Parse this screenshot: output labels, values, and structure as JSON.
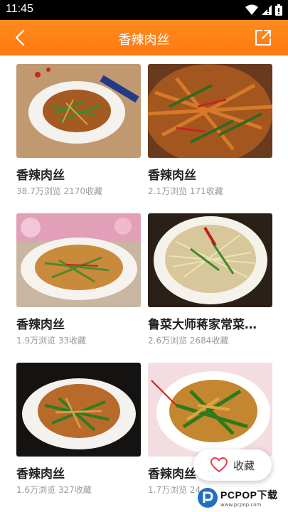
{
  "status_bar": {
    "time": "11:45",
    "icons": [
      "wifi-icon",
      "signal-icon",
      "battery-icon"
    ]
  },
  "app_bar": {
    "title": "香辣肉丝",
    "back_icon": "chevron-left-icon",
    "share_icon": "share-icon",
    "color": "#ff7f15"
  },
  "recipes": [
    {
      "title": "香辣肉丝",
      "meta": "38.7万浏览 2170收藏"
    },
    {
      "title": "香辣肉丝",
      "meta": "2.1万浏览 171收藏"
    },
    {
      "title": "香辣肉丝",
      "meta": "1.9万浏览 33收藏"
    },
    {
      "title": "鲁菜大师蒋家常菜…",
      "meta": "2.6万浏览 2684收藏"
    },
    {
      "title": "香辣肉丝",
      "meta": "1.6万浏览 327收藏"
    },
    {
      "title": "香辣肉丝",
      "meta": "1.7万浏览 24…"
    }
  ],
  "favorite_button": {
    "label": "收藏",
    "icon": "heart-icon"
  },
  "watermark": {
    "text": "PCPOP下载",
    "sub": "www.pcpop.com"
  }
}
